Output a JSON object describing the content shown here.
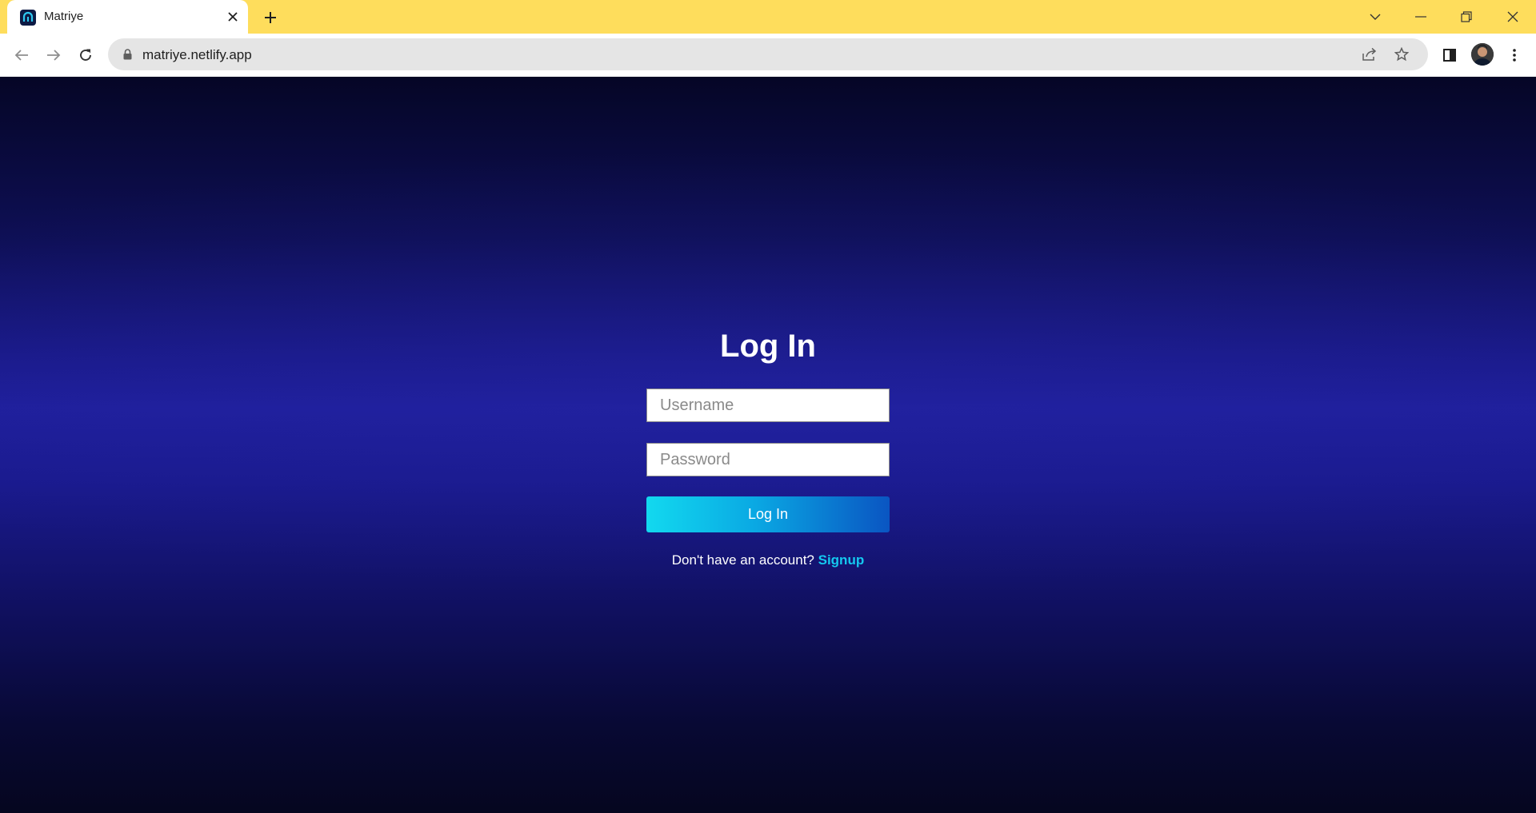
{
  "browser": {
    "tab": {
      "title": "Matriye",
      "favicon": "matriye-logo"
    },
    "address_bar": {
      "url": "matriye.netlify.app"
    },
    "colors": {
      "frame": "#fedd5c",
      "omnibox": "#e5e5e5"
    }
  },
  "login": {
    "heading": "Log In",
    "username_placeholder": "Username",
    "password_placeholder": "Password",
    "submit_label": "Log In",
    "signup_prompt": "Don't have an account?",
    "signup_link": "Signup"
  },
  "colors": {
    "background_dark": "#05061f",
    "background_mid": "#1f1f9c",
    "button_start": "#12d9ef",
    "button_end": "#0a55c2",
    "link": "#14c8ef"
  }
}
